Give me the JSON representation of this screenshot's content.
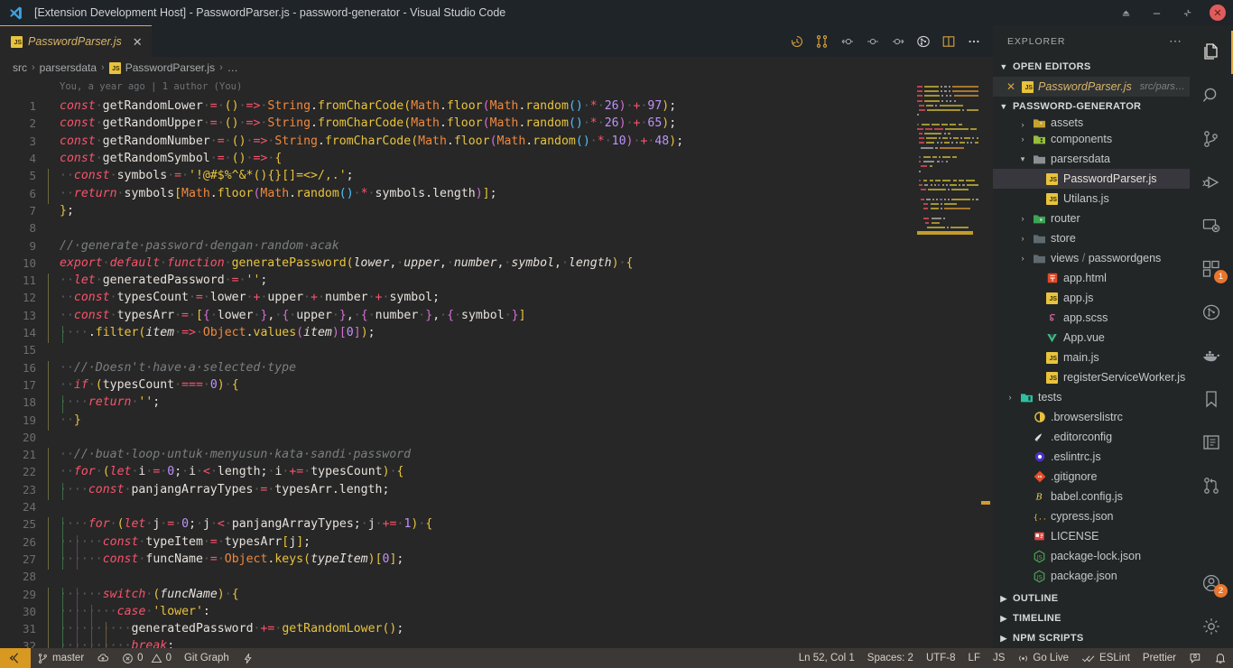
{
  "window": {
    "title": "[Extension Development Host] - PasswordParser.js - password-generator - Visual Studio Code",
    "logo_icon": "vscode-logo-icon",
    "controls": [
      {
        "name": "restore-button",
        "glyph": "▲"
      },
      {
        "name": "minimize-button",
        "glyph": "─"
      },
      {
        "name": "maximize-button",
        "glyph": "⤡"
      },
      {
        "name": "close-button",
        "glyph": "✕"
      }
    ]
  },
  "tab": {
    "label": "PasswordParser.js",
    "close_glyph": "✕",
    "file_icon": "js-file-icon"
  },
  "editor_actions": [
    {
      "name": "timeline-history-icon",
      "title": "History"
    },
    {
      "name": "compare-changes-icon",
      "title": "Compare"
    },
    {
      "name": "previous-change-icon",
      "title": "Previous change"
    },
    {
      "name": "current-change-icon",
      "title": "Current"
    },
    {
      "name": "next-change-icon",
      "title": "Next change"
    },
    {
      "name": "gitlens-blame-icon",
      "title": "GitLens"
    },
    {
      "name": "split-editor-icon",
      "title": "Split Editor"
    },
    {
      "name": "more-actions-icon",
      "title": "More Actions..."
    }
  ],
  "breadcrumb": {
    "items": [
      "src",
      "parsersdata",
      "PasswordParser.js",
      "…"
    ],
    "separator": "›"
  },
  "blame": "You, a year ago | 1 author (You)",
  "code": {
    "first_line": 1,
    "lines": [
      {
        "n": 1,
        "t": "const getRandomLower = () => String.fromCharCode(Math.floor(Math.random() * 26) + 97);"
      },
      {
        "n": 2,
        "t": "const getRandomUpper = () => String.fromCharCode(Math.floor(Math.random() * 26) + 65);"
      },
      {
        "n": 3,
        "t": "const getRandomNumber = () => String.fromCharCode(Math.floor(Math.random() * 10) + 48);"
      },
      {
        "n": 4,
        "t": "const getRandomSymbol = () => {"
      },
      {
        "n": 5,
        "t": "  const symbols = '!@#$%^&*(){}[]=<>/,.';"
      },
      {
        "n": 6,
        "t": "  return symbols[Math.floor(Math.random() * symbols.length)];"
      },
      {
        "n": 7,
        "t": "};"
      },
      {
        "n": 8,
        "t": ""
      },
      {
        "n": 9,
        "t": "// generate password dengan random acak"
      },
      {
        "n": 10,
        "t": "export default function generatePassword(lower, upper, number, symbol, length) {"
      },
      {
        "n": 11,
        "t": "  let generatedPassword = '';"
      },
      {
        "n": 12,
        "t": "  const typesCount = lower + upper + number + symbol;"
      },
      {
        "n": 13,
        "t": "  const typesArr = [{ lower }, { upper }, { number }, { symbol }]"
      },
      {
        "n": 14,
        "t": "    .filter(item => Object.values(item)[0]);"
      },
      {
        "n": 15,
        "t": ""
      },
      {
        "n": 16,
        "t": "  // Doesn't have a selected type"
      },
      {
        "n": 17,
        "t": "  if (typesCount === 0) {"
      },
      {
        "n": 18,
        "t": "    return '';"
      },
      {
        "n": 19,
        "t": "  }"
      },
      {
        "n": 20,
        "t": ""
      },
      {
        "n": 21,
        "t": "  // buat loop untuk menyusun kata sandi password"
      },
      {
        "n": 22,
        "t": "  for (let i = 0; i < length; i += typesCount) {"
      },
      {
        "n": 23,
        "t": "    const panjangArrayTypes = typesArr.length;"
      },
      {
        "n": 24,
        "t": ""
      },
      {
        "n": 25,
        "t": "    for (let j = 0; j < panjangArrayTypes; j += 1) {"
      },
      {
        "n": 26,
        "t": "      const typeItem = typesArr[j];"
      },
      {
        "n": 27,
        "t": "      const funcName = Object.keys(typeItem)[0];"
      },
      {
        "n": 28,
        "t": ""
      },
      {
        "n": 29,
        "t": "      switch (funcName) {"
      },
      {
        "n": 30,
        "t": "        case 'lower':"
      },
      {
        "n": 31,
        "t": "          generatedPassword += getRandomLower();"
      },
      {
        "n": 32,
        "t": "          break;"
      }
    ]
  },
  "explorer": {
    "header": "EXPLORER",
    "more_icon": "more-actions-icon",
    "open_editors": {
      "title": "OPEN EDITORS",
      "items": [
        {
          "name": "PasswordParser.js",
          "path": "src/pars…",
          "icon": "js-file-icon",
          "close_glyph": "✕"
        }
      ]
    },
    "project": {
      "title": "PASSWORD-GENERATOR",
      "items": [
        {
          "label": "assets",
          "type": "folder",
          "icon": "folder-assets-icon",
          "indent": 1,
          "expanded": false,
          "clipped": true
        },
        {
          "label": "components",
          "type": "folder",
          "icon": "folder-components-icon",
          "indent": 1,
          "expanded": false
        },
        {
          "label": "parsersdata",
          "type": "folder",
          "icon": "folder-open-icon",
          "indent": 1,
          "expanded": true
        },
        {
          "label": "PasswordParser.js",
          "type": "file",
          "icon": "js-file-icon",
          "indent": 2,
          "selected": true
        },
        {
          "label": "Utilans.js",
          "type": "file",
          "icon": "js-file-icon",
          "indent": 2
        },
        {
          "label": "router",
          "type": "folder",
          "icon": "folder-router-icon",
          "indent": 1,
          "expanded": false
        },
        {
          "label": "store",
          "type": "folder",
          "icon": "folder-icon",
          "indent": 1,
          "expanded": false
        },
        {
          "label": "views / passwordgens",
          "type": "folder",
          "icon": "folder-icon",
          "indent": 1,
          "expanded": false
        },
        {
          "label": "app.html",
          "type": "file",
          "icon": "html-file-icon",
          "indent": 2
        },
        {
          "label": "app.js",
          "type": "file",
          "icon": "js-file-icon",
          "indent": 2
        },
        {
          "label": "app.scss",
          "type": "file",
          "icon": "sass-file-icon",
          "indent": 2
        },
        {
          "label": "App.vue",
          "type": "file",
          "icon": "vue-file-icon",
          "indent": 2
        },
        {
          "label": "main.js",
          "type": "file",
          "icon": "js-file-icon",
          "indent": 2
        },
        {
          "label": "registerServiceWorker.js",
          "type": "file",
          "icon": "js-file-icon",
          "indent": 2
        },
        {
          "label": "tests",
          "type": "folder",
          "icon": "folder-tests-icon",
          "indent": 0,
          "expanded": false
        },
        {
          "label": ".browserslistrc",
          "type": "file",
          "icon": "browserslist-icon",
          "indent": 1
        },
        {
          "label": ".editorconfig",
          "type": "file",
          "icon": "editorconfig-icon",
          "indent": 1
        },
        {
          "label": ".eslintrc.js",
          "type": "file",
          "icon": "eslint-icon",
          "indent": 1
        },
        {
          "label": ".gitignore",
          "type": "file",
          "icon": "git-icon",
          "indent": 1
        },
        {
          "label": "babel.config.js",
          "type": "file",
          "icon": "babel-icon",
          "indent": 1
        },
        {
          "label": "cypress.json",
          "type": "file",
          "icon": "json-icon",
          "indent": 1
        },
        {
          "label": "LICENSE",
          "type": "file",
          "icon": "license-icon",
          "indent": 1
        },
        {
          "label": "package-lock.json",
          "type": "file",
          "icon": "npm-icon",
          "indent": 1
        },
        {
          "label": "package.json",
          "type": "file",
          "icon": "npm-icon",
          "indent": 1
        }
      ]
    },
    "bottom_sections": [
      {
        "title": "OUTLINE"
      },
      {
        "title": "TIMELINE"
      },
      {
        "title": "NPM SCRIPTS"
      }
    ]
  },
  "activity_bar": {
    "items": [
      {
        "name": "explorer-icon",
        "active": true
      },
      {
        "name": "search-icon",
        "active": false
      },
      {
        "name": "source-control-icon",
        "active": false
      },
      {
        "name": "run-debug-icon",
        "active": false
      },
      {
        "name": "remote-explorer-icon",
        "active": false
      },
      {
        "name": "extensions-icon",
        "active": false,
        "badge": "1"
      },
      {
        "name": "git-graph-icon",
        "active": false
      },
      {
        "name": "docker-icon",
        "active": false
      },
      {
        "name": "bookmarks-icon",
        "active": false
      },
      {
        "name": "todo-tree-icon",
        "active": false
      },
      {
        "name": "gitlens-icon",
        "active": false
      }
    ],
    "bottom_items": [
      {
        "name": "accounts-icon",
        "badge": "2"
      },
      {
        "name": "settings-gear-icon"
      }
    ]
  },
  "status_bar": {
    "remote_icon": "remote-window-icon",
    "left": [
      {
        "name": "branch-status",
        "icon": "git-branch-icon",
        "label": "master"
      },
      {
        "name": "sync-status",
        "icon": "sync-cloud-icon",
        "label": ""
      },
      {
        "name": "problems-status",
        "icon": "error-warning-icon",
        "label": "0  0",
        "errors": "0",
        "warnings": "0"
      },
      {
        "name": "git-graph-status",
        "icon": "",
        "label": "Git Graph"
      },
      {
        "name": "gitlens-status",
        "icon": "gitlens-bolt-icon",
        "label": ""
      }
    ],
    "right": [
      {
        "name": "cursor-position-status",
        "label": "Ln 52, Col 1"
      },
      {
        "name": "indentation-status",
        "label": "Spaces: 2"
      },
      {
        "name": "encoding-status",
        "label": "UTF-8"
      },
      {
        "name": "eol-status",
        "label": "LF"
      },
      {
        "name": "language-mode-status",
        "label": "JS"
      },
      {
        "name": "go-live-status",
        "label": "Go Live",
        "icon": "broadcast-icon"
      },
      {
        "name": "eslint-status",
        "label": "ESLint",
        "icon": "check-check-icon"
      },
      {
        "name": "prettier-status",
        "label": "Prettier"
      },
      {
        "name": "feedback-status",
        "label": "",
        "icon": "feedback-icon"
      },
      {
        "name": "notifications-status",
        "label": "",
        "icon": "bell-icon"
      }
    ]
  },
  "colors": {
    "accent": "#e8a33d",
    "editor_bg": "#272727",
    "sidebar_bg": "#222627",
    "titlebar_bg": "#1f2428",
    "statusbar_bg": "#3c3836",
    "badge": "#e8762c",
    "keyword": "#f9536b",
    "string": "#e8c33d",
    "builtin": "#f0883e",
    "number": "#bd93f9",
    "comment": "#7b7e80"
  }
}
